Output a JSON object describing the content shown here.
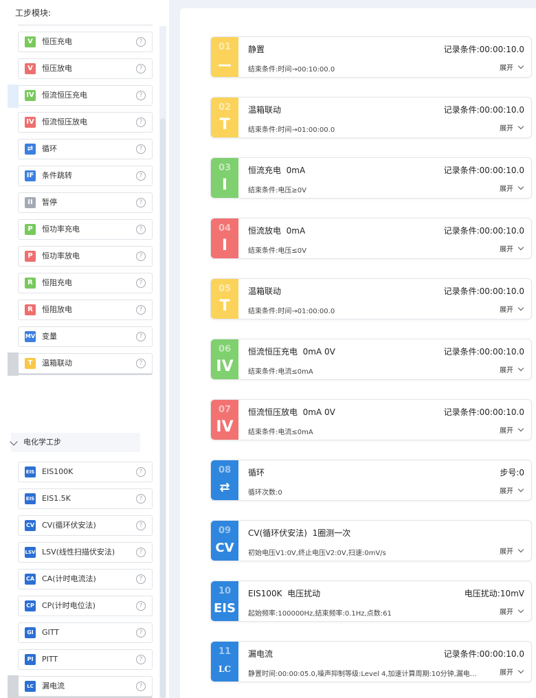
{
  "left_panel": {
    "title": "工步模块:",
    "modules": [
      {
        "icon": "V",
        "label": "恒压充电",
        "color": "#79c95d"
      },
      {
        "icon": "V",
        "label": "恒压放电",
        "color": "#ee6f6f"
      },
      {
        "icon": "IV",
        "label": "恒流恒压充电",
        "color": "#79c95d"
      },
      {
        "icon": "IV",
        "label": "恒流恒压放电",
        "color": "#ee6f6f"
      },
      {
        "icon": "loop-icon",
        "label": "循环",
        "color": "#3d7fe0"
      },
      {
        "icon": "IF",
        "label": "条件跳转",
        "color": "#3d7fe0"
      },
      {
        "icon": "II",
        "label": "暂停",
        "color": "#a3aab4"
      },
      {
        "icon": "P",
        "label": "恒功率充电",
        "color": "#79c95d"
      },
      {
        "icon": "P",
        "label": "恒功率放电",
        "color": "#ee6f6f"
      },
      {
        "icon": "R",
        "label": "恒阻充电",
        "color": "#79c95d"
      },
      {
        "icon": "R",
        "label": "恒阻放电",
        "color": "#ee6f6f"
      },
      {
        "icon": "MV",
        "label": "变量",
        "color": "#3d7fe0"
      },
      {
        "icon": "T",
        "label": "温箱联动",
        "color": "#f9c848"
      }
    ],
    "group_title": "电化学工步",
    "echem_modules": [
      {
        "icon": "EIS",
        "label": "EIS100K"
      },
      {
        "icon": "EIS",
        "label": "EIS1.5K"
      },
      {
        "icon": "CV",
        "label": "CV(循环伏安法)"
      },
      {
        "icon": "LSV",
        "label": "LSV(线性扫描伏安法)"
      },
      {
        "icon": "CA",
        "label": "CA(计时电流法)"
      },
      {
        "icon": "CP",
        "label": "CP(计时电位法)"
      },
      {
        "icon": "GI",
        "label": "GITT"
      },
      {
        "icon": "PI",
        "label": "PITT"
      },
      {
        "icon": "LC",
        "label": "漏电流"
      }
    ],
    "help_glyph": "?"
  },
  "steps": [
    {
      "num": "01",
      "symbol": "—",
      "color": "yellow",
      "title": "静置",
      "record": "记录条件:00:00:10.0",
      "end": "结束条件:时间→00:10:00.0"
    },
    {
      "num": "02",
      "symbol": "T",
      "color": "yellow",
      "title": "温箱联动",
      "record": "记录条件:00:00:10.0",
      "end": "结束条件:时间→01:00:00.0"
    },
    {
      "num": "03",
      "symbol": "I",
      "color": "green",
      "title": "恒流充电  0mA",
      "record": "记录条件:00:00:10.0",
      "end": "结束条件:电压≥0V"
    },
    {
      "num": "04",
      "symbol": "I",
      "color": "red",
      "title": "恒流放电  0mA",
      "record": "记录条件:00:00:10.0",
      "end": "结束条件:电压≤0V"
    },
    {
      "num": "05",
      "symbol": "T",
      "color": "yellow",
      "title": "温箱联动",
      "record": "记录条件:00:00:10.0",
      "end": "结束条件:时间→01:00:00.0"
    },
    {
      "num": "06",
      "symbol": "IV",
      "color": "green",
      "title": "恒流恒压充电  0mA 0V",
      "record": "记录条件:00:00:10.0",
      "end": "结束条件:电流≤0mA"
    },
    {
      "num": "07",
      "symbol": "IV",
      "color": "red",
      "title": "恒流恒压放电  0mA 0V",
      "record": "记录条件:00:00:10.0",
      "end": "结束条件:电流≤0mA"
    },
    {
      "num": "08",
      "symbol": "⇄",
      "color": "blue",
      "title": "循环",
      "record": "步号:0",
      "end": "循环次数:0"
    },
    {
      "num": "09",
      "symbol": "CV",
      "color": "blue",
      "title": "CV(循环伏安法)  1圈测一次",
      "record": "",
      "end": "初始电压V1:0V,终止电压V2:0V,扫速:0mV/s"
    },
    {
      "num": "10",
      "symbol": "EIS",
      "color": "blue",
      "title": "EIS100K  电压扰动",
      "record": "电压扰动:10mV",
      "end": "起始频率:100000Hz,结束频率:0.1Hz,点数:61"
    },
    {
      "num": "11",
      "symbol": "LC",
      "color": "blue",
      "title": "漏电流",
      "record": "记录条件:00:00:10.0",
      "end": "静置时间:00:00:05.0,噪声抑制等级:Level 4,加速计算周期:10分钟,漏电流起..."
    }
  ],
  "expand_label": "展开"
}
